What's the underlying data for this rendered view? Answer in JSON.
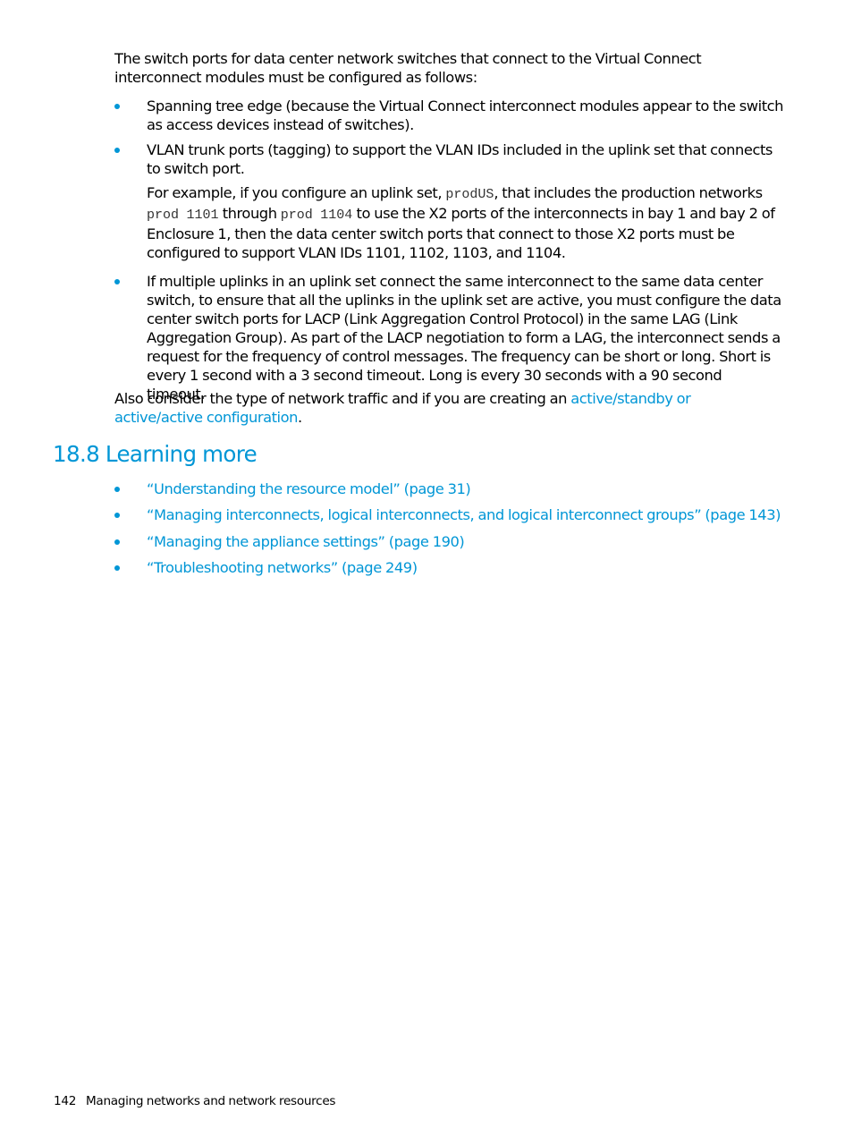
{
  "intro": {
    "text": "The switch ports for data center network switches that connect to the Virtual Connect interconnect modules must be configured as follows:"
  },
  "requirements": [
    {
      "text": "Spanning tree edge (because the Virtual Connect interconnect modules appear to the switch as access devices instead of switches)."
    },
    {
      "text": "VLAN trunk ports (tagging) to support the VLAN IDs included in the uplink set that connects to switch port.",
      "example": {
        "part1": "For example, if you configure an uplink set, ",
        "code1": "prodUS",
        "part2": ", that includes the production networks ",
        "code2": "prod 1101",
        "part3": " through ",
        "code3": "prod 1104",
        "part4": " to use the X2 ports of the interconnects in bay 1 and bay 2 of Enclosure 1, then the data center switch ports that connect to those X2 ports must be configured to support VLAN IDs 1101, 1102, 1103, and 1104."
      }
    },
    {
      "text": "If multiple uplinks in an uplink set connect the same interconnect to the same data center switch, to ensure that all the uplinks in the uplink set are active, you must configure the data center switch ports for LACP (Link Aggregation Control Protocol) in the same LAG (Link Aggregation Group). As part of the LACP negotiation to form a LAG, the interconnect sends a request for the frequency of control messages. The frequency can be short or long. Short is every 1 second with a 3 second timeout. Long is every 30 seconds with a 90 second timeout."
    }
  ],
  "also_consider": {
    "text": "Also consider the type of network traffic and if you are creating an ",
    "link": "active/standby or active/active configuration",
    "end": "."
  },
  "section": {
    "heading": "18.8 Learning more",
    "links": [
      {
        "label": "“Understanding the resource model” (page 31)"
      },
      {
        "label": "“Managing interconnects, logical interconnects, and logical interconnect groups” (page 143)"
      },
      {
        "label": "“Managing the appliance settings” (page 190)"
      },
      {
        "label": "“Troubleshooting networks” (page 249)"
      }
    ]
  },
  "footer": {
    "page_number": "142",
    "chapter_title": "Managing networks and network resources"
  },
  "colors": {
    "accent": "#0096d6",
    "text": "#000000"
  }
}
